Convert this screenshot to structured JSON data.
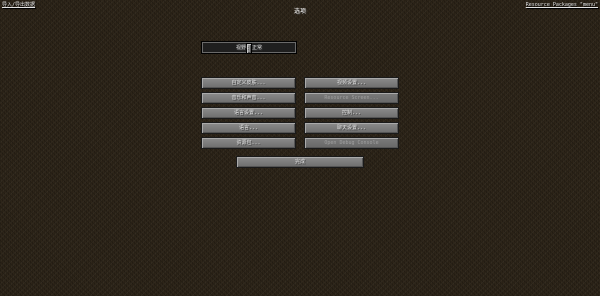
{
  "header": {
    "top_left_link": "导入/导出数据",
    "top_right_link": "Resource Packages \"menu\"",
    "title": "选项"
  },
  "fov_slider": {
    "label": "视野: 正常",
    "value_fraction": 0.5
  },
  "buttons": {
    "customize_skin": "自定义皮肤...",
    "video_settings": "视频设置...",
    "music_sound": "音乐和声音...",
    "resource_screen": "Resource Screen...",
    "language_settings": "语言设置...",
    "controls": "控制...",
    "language": "语言...",
    "chat_settings": "聊天设置...",
    "resource_packs": "资源包...",
    "open_debug": "Open Debug Console",
    "done": "完成"
  }
}
